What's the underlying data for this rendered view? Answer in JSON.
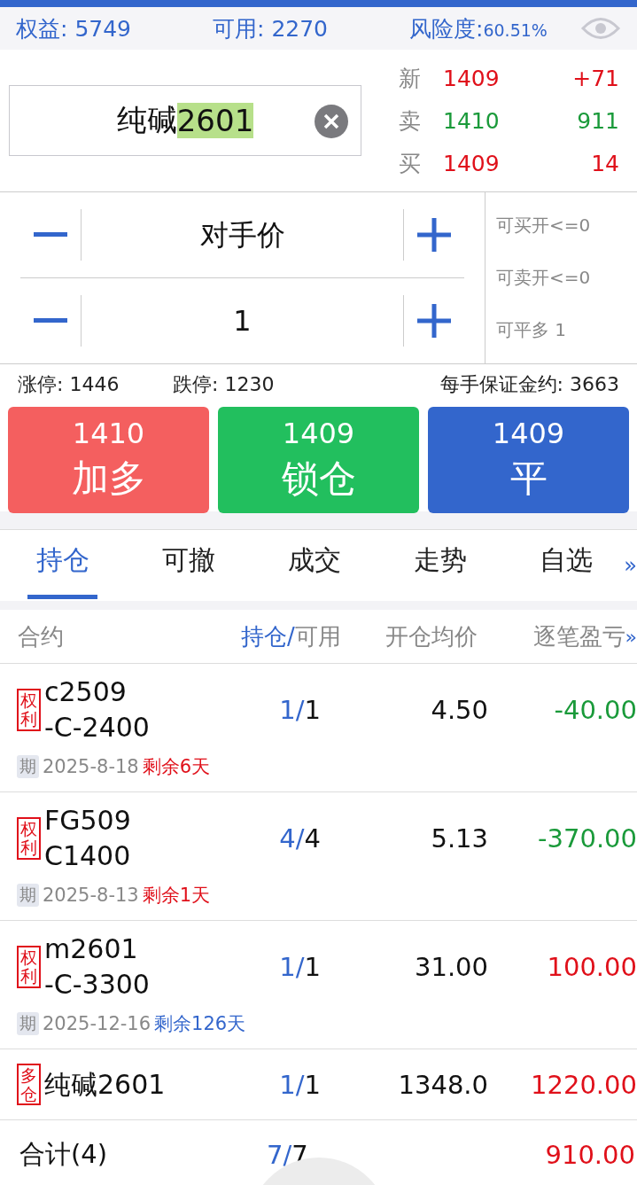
{
  "account": {
    "equity_label": "权益:",
    "equity": "5749",
    "available_label": "可用:",
    "available": "2270",
    "risk_label": "风险度:",
    "risk": "60.51%"
  },
  "symbol_field": {
    "name": "纯碱",
    "code": "2601"
  },
  "quotes": [
    {
      "label": "新",
      "price": "1409",
      "change": "+71",
      "color": "#e0101a"
    },
    {
      "label": "卖",
      "price": "1410",
      "change": "911",
      "color": "#1a9a3a"
    },
    {
      "label": "买",
      "price": "1409",
      "change": "14",
      "color": "#e0101a"
    }
  ],
  "order": {
    "price_mode": "对手价",
    "quantity": "1",
    "limits": [
      "可买开<=0",
      "可卖开<=0",
      "可平多 1"
    ]
  },
  "info": {
    "limit_up": "涨停: 1446",
    "limit_down": "跌停: 1230",
    "margin": "每手保证金约: 3663"
  },
  "actions": [
    {
      "price": "1410",
      "label": "加多",
      "kind": "buy"
    },
    {
      "price": "1409",
      "label": "锁仓",
      "kind": "lock"
    },
    {
      "price": "1409",
      "label": "平",
      "kind": "close"
    }
  ],
  "tabs": [
    {
      "label": "持仓",
      "selected": true
    },
    {
      "label": "可撤",
      "selected": false
    },
    {
      "label": "成交",
      "selected": false
    },
    {
      "label": "走势",
      "selected": false
    },
    {
      "label": "自选",
      "selected": false
    }
  ],
  "tab_more": "»",
  "table": {
    "columns": [
      {
        "label": "合约"
      },
      {
        "primary": "持仓/",
        "label": "可用"
      },
      {
        "label": "开仓均价"
      },
      {
        "label": "逐笔盈亏"
      }
    ],
    "more": "»",
    "rows": [
      {
        "tag": "权利",
        "name_lines": [
          "c2509",
          "-C-2400"
        ],
        "held": "1/",
        "available": "1",
        "avg_price": "4.50",
        "pnl": "-40.00",
        "color": "#1a9a3a",
        "expiry_tag": "期",
        "expiry": "2025-8-18",
        "remaining": "剩余6天",
        "urgent": true
      },
      {
        "tag": "权利",
        "name_lines": [
          "FG509",
          "C1400"
        ],
        "held": "4/",
        "available": "4",
        "avg_price": "5.13",
        "pnl": "-370.00",
        "color": "#1a9a3a",
        "expiry_tag": "期",
        "expiry": "2025-8-13",
        "remaining": "剩余1天",
        "urgent": true
      },
      {
        "tag": "权利",
        "name_lines": [
          "m2601",
          "-C-3300"
        ],
        "held": "1/",
        "available": "1",
        "avg_price": "31.00",
        "pnl": "100.00",
        "color": "#e0101a",
        "expiry_tag": "期",
        "expiry": "2025-12-16",
        "remaining": "剩余126天",
        "urgent": false
      },
      {
        "tag": "多仓",
        "name_lines": [
          "纯碱2601"
        ],
        "held": "1/",
        "available": "1",
        "avg_price": "1348.0",
        "pnl": "1220.00",
        "color": "#e0101a"
      }
    ],
    "total": {
      "label": "合计(4)",
      "held": "7/",
      "available": "7",
      "pnl": "910.00",
      "color": "#e0101a"
    }
  }
}
